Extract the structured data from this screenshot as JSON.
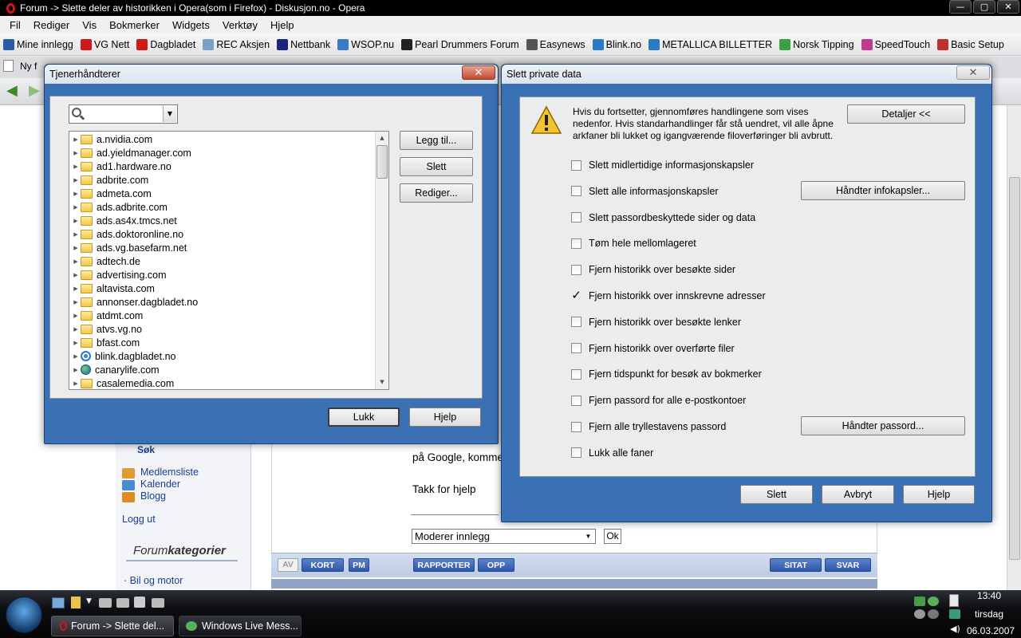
{
  "window": {
    "title": "Forum -> Slette deler av historikken i Opera(som i Firefox) - Diskusjon.no - Opera",
    "controls": [
      "—",
      "▢",
      "✕"
    ]
  },
  "menu": [
    "Fil",
    "Rediger",
    "Vis",
    "Bokmerker",
    "Widgets",
    "Verktøy",
    "Hjelp"
  ],
  "bookmarks": [
    {
      "label": "Mine innlegg",
      "color": "#2a5aa8"
    },
    {
      "label": "VG Nett",
      "color": "#d01818"
    },
    {
      "label": "Dagbladet",
      "color": "#d01818"
    },
    {
      "label": "REC Aksjen",
      "color": "#7aa0c8"
    },
    {
      "label": "Nettbank",
      "color": "#1a237e"
    },
    {
      "label": "WSOP.nu",
      "color": "#3a7ac8"
    },
    {
      "label": "Pearl Drummers Forum",
      "color": "#222222"
    },
    {
      "label": "Easynews",
      "color": "#555555"
    },
    {
      "label": "Blink.no",
      "color": "#2a7ac8"
    },
    {
      "label": "METALLICA BILLETTER",
      "color": "#2a7ac8"
    },
    {
      "label": "Norsk Tipping",
      "color": "#3aa040"
    },
    {
      "label": "SpeedTouch",
      "color": "#c03a90"
    },
    {
      "label": "Basic Setup",
      "color": "#c03030"
    }
  ],
  "tabs": {
    "new_tab": "Ny f"
  },
  "page": {
    "sok": "Søk",
    "sidebar_links": [
      "Medlemsliste",
      "Kalender",
      "Blogg"
    ],
    "logg_ut": "Logg ut",
    "forum_kat_prefix": "Forum",
    "forum_kat_suffix": "kategorier",
    "bil": "· Bil og motor",
    "post_line1": "på Google, komme",
    "post_line2": "Takk for hjelp",
    "moderer": "Moderer innlegg",
    "ok": "Ok",
    "post_buttons": {
      "av": "AV",
      "kort": "KORT",
      "pm": "PM",
      "rapporter": "RAPPORTER",
      "opp": "OPP",
      "sitat": "SITAT",
      "svar": "SVAR"
    }
  },
  "server_dialog": {
    "title": "Tjenerhåndterer",
    "add": "Legg til...",
    "delete": "Slett",
    "edit": "Rediger...",
    "close": "Lukk",
    "help": "Hjelp",
    "sites": [
      {
        "name": "a.nvidia.com",
        "icon": "folder"
      },
      {
        "name": "ad.yieldmanager.com",
        "icon": "folder"
      },
      {
        "name": "ad1.hardware.no",
        "icon": "folder"
      },
      {
        "name": "adbrite.com",
        "icon": "folder"
      },
      {
        "name": "admeta.com",
        "icon": "folder"
      },
      {
        "name": "ads.adbrite.com",
        "icon": "folder"
      },
      {
        "name": "ads.as4x.tmcs.net",
        "icon": "folder"
      },
      {
        "name": "ads.doktoronline.no",
        "icon": "folder"
      },
      {
        "name": "ads.vg.basefarm.net",
        "icon": "folder"
      },
      {
        "name": "adtech.de",
        "icon": "folder"
      },
      {
        "name": "advertising.com",
        "icon": "folder"
      },
      {
        "name": "altavista.com",
        "icon": "folder"
      },
      {
        "name": "annonser.dagbladet.no",
        "icon": "folder"
      },
      {
        "name": "atdmt.com",
        "icon": "folder"
      },
      {
        "name": "atvs.vg.no",
        "icon": "folder"
      },
      {
        "name": "bfast.com",
        "icon": "folder"
      },
      {
        "name": "blink.dagbladet.no",
        "icon": "ring"
      },
      {
        "name": "canarylife.com",
        "icon": "globe"
      },
      {
        "name": "casalemedia.com",
        "icon": "folder"
      }
    ]
  },
  "private_dialog": {
    "title": "Slett private data",
    "warning": "Hvis du fortsetter, gjennomføres handlingene som vises nedenfor. Hvis standarhandlinger får stå uendret, vil alle åpne arkfaner bli lukket og igangværende filoverføringer bli avbrutt.",
    "details": "Detaljer <<",
    "manage_cookies": "Håndter infokapsler...",
    "manage_passwords": "Håndter passord...",
    "delete": "Slett",
    "cancel": "Avbryt",
    "help": "Hjelp",
    "options": [
      {
        "label": "Slett midlertidige informasjonskapsler",
        "checked": false
      },
      {
        "label": "Slett alle informasjonskapsler",
        "checked": false
      },
      {
        "label": "Slett passordbeskyttede sider og data",
        "checked": false
      },
      {
        "label": "Tøm hele mellomlageret",
        "checked": false
      },
      {
        "label": "Fjern historikk over besøkte sider",
        "checked": false
      },
      {
        "label": "Fjern historikk over innskrevne adresser",
        "checked": true
      },
      {
        "label": "Fjern historikk over besøkte lenker",
        "checked": false
      },
      {
        "label": "Fjern historikk over overførte filer",
        "checked": false
      },
      {
        "label": "Fjern tidspunkt for besøk av bokmerker",
        "checked": false
      },
      {
        "label": "Fjern passord for alle e-postkontoer",
        "checked": false
      },
      {
        "label": "Fjern alle tryllestavens passord",
        "checked": false
      },
      {
        "label": "Lukk alle faner",
        "checked": false
      }
    ]
  },
  "taskbar": {
    "tasks": [
      {
        "label": "Forum -> Slette del...",
        "active": true
      },
      {
        "label": "Windows Live Mess...",
        "active": false
      }
    ],
    "time": "13:40",
    "day": "tirsdag",
    "date": "06.03.2007"
  }
}
